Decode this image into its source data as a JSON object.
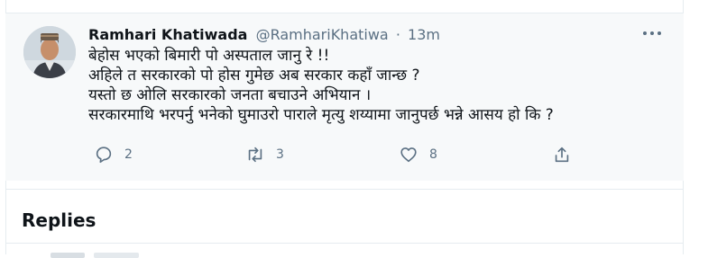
{
  "tweet": {
    "author_name": "Ramhari Khatiwada",
    "handle": "@RamhariKhatiwa",
    "separator": "·",
    "time": "13m",
    "lines": [
      "बेहोस भएको  बिमारी पो अस्पताल  जानु  रे !!",
      "अहिले त सरकारको पो होस  गुमेछ अब सरकार  कहाँ  जान्छ ?",
      "यस्तो छ ओलि सरकारको जनता बचाउने अभियान ।",
      "सरकारमाथि  भरपर्नु  भनेको घुमाउरो पाराले मृत्यु शय्यामा जानुपर्छ  भन्ने  आसय  हो कि ?"
    ],
    "actions": {
      "reply_count": "2",
      "retweet_count": "3",
      "like_count": "8"
    }
  },
  "replies": {
    "heading": "Replies"
  },
  "icons": {
    "more": "more-horizontal-icon",
    "reply": "reply-bubble-icon",
    "retweet": "retweet-icon",
    "like": "heart-icon",
    "share": "share-icon"
  },
  "colors": {
    "text_primary": "#0f1419",
    "text_secondary": "#5b7083",
    "tweet_background": "#f7f9fa",
    "border": "#e6ecf0"
  }
}
